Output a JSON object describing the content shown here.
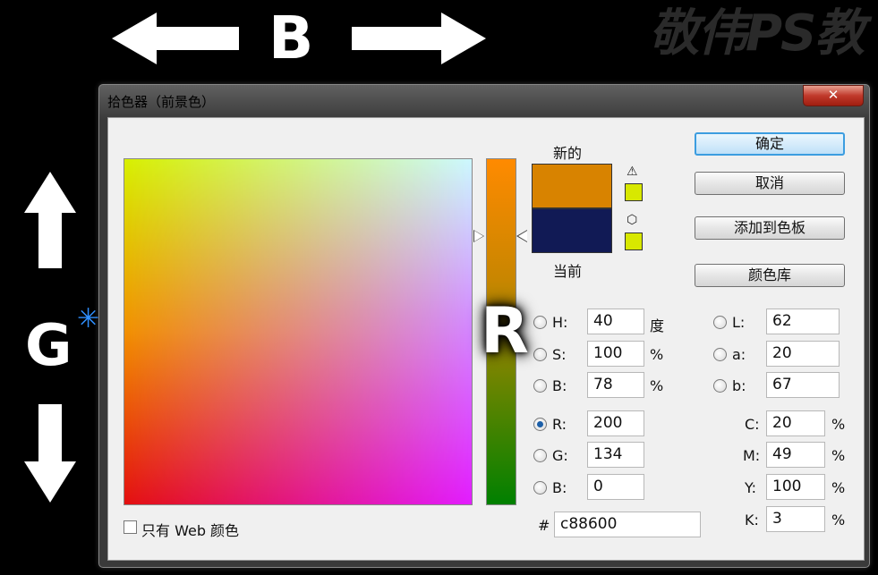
{
  "overlay": {
    "letter_b": "B",
    "letter_g": "G",
    "letter_r": "R",
    "watermark": "敬伟PS教"
  },
  "dialog": {
    "title": "拾色器（前景色）",
    "close_label": "✕"
  },
  "swatches": {
    "new_label": "新的",
    "current_label": "当前",
    "new_color": "#d88300",
    "current_color": "#111a55",
    "warning_color": "#d8e800"
  },
  "buttons": {
    "ok": "确定",
    "cancel": "取消",
    "add_to_swatches": "添加到色板",
    "color_libraries": "颜色库"
  },
  "hsb": {
    "h_label": "H:",
    "h_value": "40",
    "h_unit": "度",
    "s_label": "S:",
    "s_value": "100",
    "s_unit": "%",
    "b_label": "B:",
    "b_value": "78",
    "b_unit": "%"
  },
  "rgb": {
    "r_label": "R:",
    "r_value": "200",
    "g_label": "G:",
    "g_value": "134",
    "b_label": "B:",
    "b_value": "0",
    "selected": "R"
  },
  "lab": {
    "l_label": "L:",
    "l_value": "62",
    "a_label": "a:",
    "a_value": "20",
    "b_label": "b:",
    "b_value": "67"
  },
  "cmyk": {
    "c_label": "C:",
    "c_value": "20",
    "m_label": "M:",
    "m_value": "49",
    "y_label": "Y:",
    "y_value": "100",
    "k_label": "K:",
    "k_value": "3",
    "unit": "%"
  },
  "hex": {
    "label": "#",
    "value": "c88600"
  },
  "web_only": {
    "label": "只有 Web 颜色"
  }
}
